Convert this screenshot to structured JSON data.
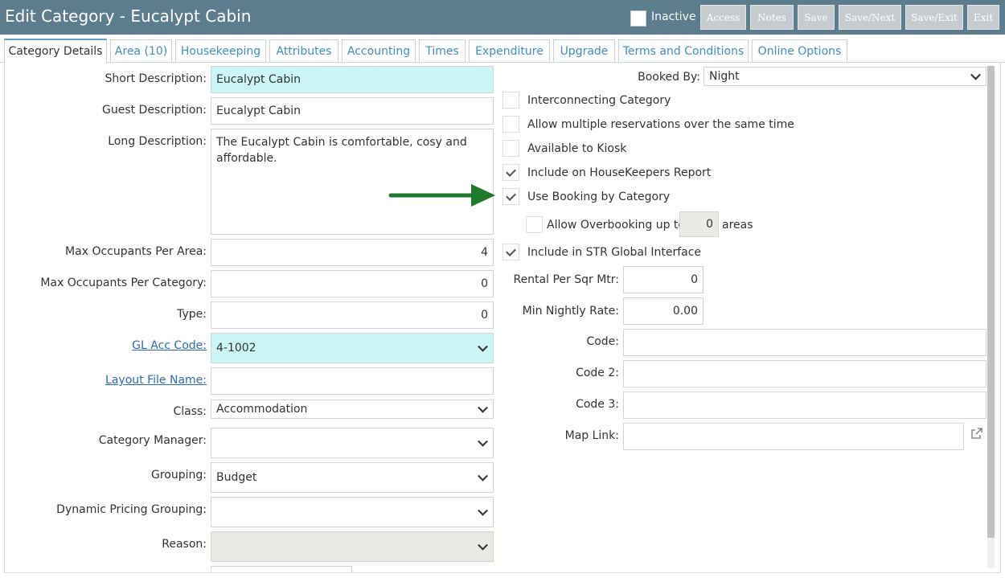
{
  "header": {
    "title": "Edit Category - Eucalypt Cabin",
    "inactive_label": "Inactive",
    "buttons": [
      "Access",
      "Notes",
      "Save",
      "Save/Next",
      "Save/Exit",
      "Exit"
    ]
  },
  "tabs": [
    "Category Details",
    "Area (10)",
    "Housekeeping",
    "Attributes",
    "Accounting",
    "Times",
    "Expenditure",
    "Upgrade",
    "Terms and Conditions",
    "Online Options"
  ],
  "left": {
    "short_desc": {
      "label": "Short Description:",
      "value": "Eucalypt Cabin"
    },
    "guest_desc": {
      "label": "Guest Description:",
      "value": "Eucalypt Cabin"
    },
    "long_desc": {
      "label": "Long Description:",
      "value": "The Eucalypt Cabin is comfortable, cosy and affordable."
    },
    "max_per_area": {
      "label": "Max Occupants Per Area:",
      "value": "4"
    },
    "max_per_category": {
      "label": "Max Occupants Per Category:",
      "value": "0"
    },
    "type": {
      "label": "Type:",
      "value": "0"
    },
    "gl_acc": {
      "label": "GL Acc Code:",
      "value": "4-1002"
    },
    "layout_file": {
      "label": "Layout File Name:",
      "value": ""
    },
    "class": {
      "label": "Class:",
      "value": "Accommodation"
    },
    "category_manager": {
      "label": "Category Manager:",
      "value": ""
    },
    "grouping": {
      "label": "Grouping:",
      "value": "Budget"
    },
    "dynamic_pricing": {
      "label": "Dynamic Pricing Grouping:",
      "value": ""
    },
    "reason": {
      "label": "Reason:",
      "value": ""
    }
  },
  "right": {
    "booked_by": {
      "label": "Booked By:",
      "value": "Night"
    },
    "checkboxes": [
      {
        "label": "Interconnecting Category",
        "checked": false
      },
      {
        "label": "Allow multiple reservations over the same time",
        "checked": false
      },
      {
        "label": "Available to Kiosk",
        "checked": false
      },
      {
        "label": "Include on HouseKeepers Report",
        "checked": true
      },
      {
        "label": "Use Booking by Category",
        "checked": true
      }
    ],
    "overbooking": {
      "label": "Allow Overbooking up to",
      "value": "0",
      "suffix": "areas",
      "checked": false
    },
    "str_global": {
      "label": "Include in STR Global Interface",
      "checked": true
    },
    "rental_sqm": {
      "label": "Rental Per Sqr Mtr:",
      "value": "0"
    },
    "min_nightly": {
      "label": "Min Nightly Rate:",
      "value": "0.00"
    },
    "code": {
      "label": "Code:",
      "value": ""
    },
    "code2": {
      "label": "Code 2:",
      "value": ""
    },
    "code3": {
      "label": "Code 3:",
      "value": ""
    },
    "map_link": {
      "label": "Map Link:",
      "value": ""
    }
  },
  "colors": {
    "titlebar": "#5b7d8d",
    "cyan_field": "#ccf5f7",
    "arrow": "#1f7a2c",
    "link": "#2a6db5"
  },
  "icons": [
    "chevron-down-icon",
    "checkmark-icon",
    "external-link-icon",
    "arrow-pointer-icon"
  ]
}
